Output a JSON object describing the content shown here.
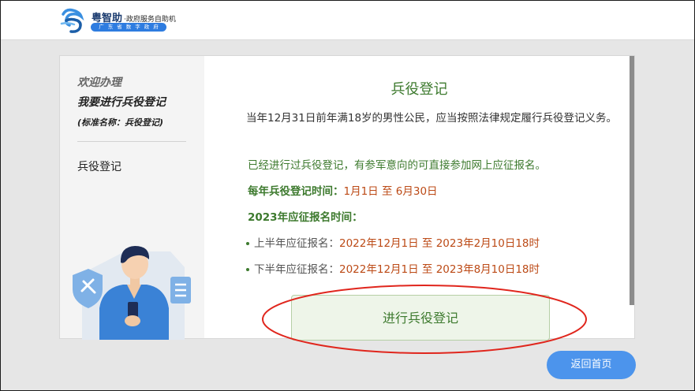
{
  "header": {
    "brand_name": "粤智助",
    "brand_sub": "·政府服务自助机",
    "brand_pill": "广东省数字政府",
    "logo_icon": "yue-logo-icon"
  },
  "sidebar": {
    "welcome": "欢迎办理",
    "apply_title": "我要进行兵役登记",
    "standard_name": "(标准名称：兵役登记)",
    "item": "兵役登记"
  },
  "content": {
    "title": "兵役登记",
    "paragraph": "当年12月31日前年满18岁的男性公民，应当按照法律规定履行兵役登记义务。",
    "note": "已经进行过兵役登记，有参军意向的可直接参加网上应征报名。",
    "reg_time_label": "每年兵役登记时间：",
    "reg_time_value": "1月1日 至 6月30日",
    "enlist_label": "2023年应征报名时间：",
    "first_half_label": "上半年应征报名：",
    "first_half_value": "2022年12月1日 至 2023年2月10日18时",
    "second_half_label": "下半年应征报名：",
    "second_half_value": "2022年12月1日 至 2023年8月10日18时",
    "register_button": "进行兵役登记"
  },
  "footer": {
    "home_button": "返回首页"
  },
  "colors": {
    "accent_green": "#3d7a2e",
    "date_red": "#bc4a16",
    "button_blue": "#4c94ec",
    "annotation_red": "#e0261d"
  }
}
